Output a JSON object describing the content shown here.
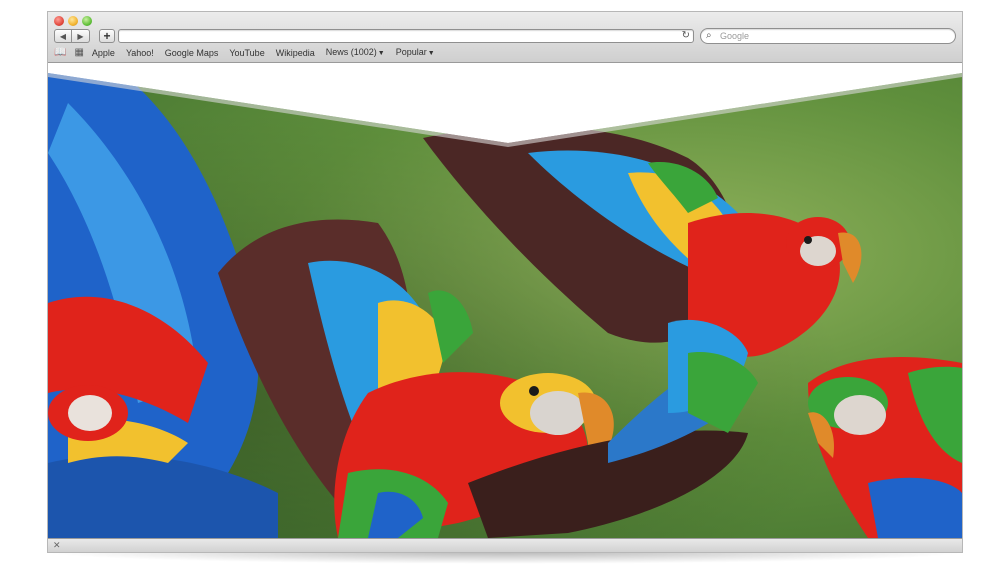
{
  "browser": {
    "url": "",
    "search_placeholder": "Google",
    "icons": {
      "back": "back-arrow-icon",
      "forward": "forward-arrow-icon",
      "add": "plus-icon",
      "reload": "reload-icon",
      "search": "search-icon",
      "reading_list": "book-icon",
      "top_sites": "grid-icon",
      "close_status": "close-icon"
    },
    "bookmarks": [
      "Apple",
      "Yahoo!",
      "Google Maps",
      "YouTube",
      "Wikipedia",
      "News (1002)",
      "Popular"
    ]
  },
  "page": {
    "image": "Scarlet macaws in flight over blurred green foliage",
    "colors": {
      "foliage": "#5f8f3c",
      "macaw_red": "#e0231b",
      "macaw_blue": "#1f63c9",
      "macaw_yellow": "#f2c12e",
      "macaw_green": "#3aa53a"
    }
  }
}
